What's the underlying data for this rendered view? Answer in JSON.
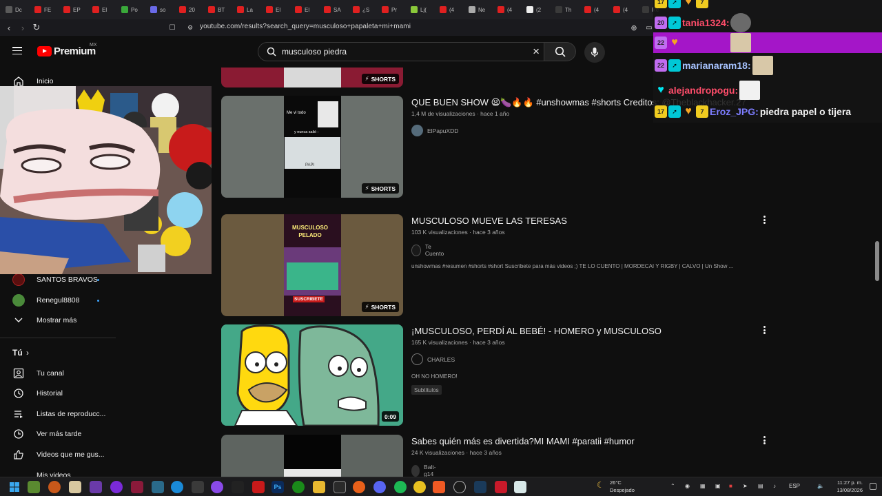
{
  "browser": {
    "tabs": [
      "Dc",
      "FE",
      "EP",
      "El",
      "Po",
      "so",
      "20",
      "BT",
      "La",
      "El",
      "El",
      "SA",
      "¿S",
      "Pr",
      "Lj(",
      "(4",
      "Ne",
      "(4",
      "(2",
      "Th",
      "(4",
      "(4",
      "Re"
    ],
    "url": "youtube.com/results?search_query=musculoso+papaleta+mi+mami"
  },
  "youtube": {
    "logo_text": "Premium",
    "country_code": "MX",
    "search_value": "musculoso piedra",
    "sidebar": {
      "home_label": "Inicio",
      "subscriptions": [
        {
          "label": "SANTOS BRAVOS"
        },
        {
          "label": "Renegul8808"
        }
      ],
      "show_more": "Mostrar más",
      "you_section": "Tú",
      "you_items": [
        {
          "label": "Tu canal",
          "icon": "channel-icon"
        },
        {
          "label": "Historial",
          "icon": "history-icon"
        },
        {
          "label": "Listas de reproducc...",
          "icon": "playlist-icon"
        },
        {
          "label": "Ver más tarde",
          "icon": "clock-icon"
        },
        {
          "label": "Videos que me gus...",
          "icon": "like-icon"
        },
        {
          "label": "Mis videos",
          "icon": "video-icon"
        }
      ]
    },
    "results": [
      {
        "title": "QUE BUEN SHOW 😫🍆🔥🔥 #unshowmas #shorts Creditos: @Theblackhacker.27",
        "views": "1,4 M de visualizaciones",
        "age": "hace 1 año",
        "channel": "ElPapuXDD",
        "badge": "SHORTS",
        "thumb_text_top": "Me vi todo",
        "thumb_text_mid": "y nunca salió :",
        "thumb_text_bottom": "PAPI"
      },
      {
        "title": "MUSCULOSO MUEVE LAS TERESAS",
        "views": "103 K visualizaciones",
        "age": "hace 3 años",
        "channel": "Te Cuento",
        "description": "unshowmas #resumen #shorts #short Suscribete para más videos ;) TE LO CUENTO | MORDECAI Y RIGBY | CALVO | Un Show ...",
        "badge": "SHORTS",
        "thumb_text_top": "MUSCULOSO PELADO",
        "thumb_text_bottom": "SUSCRIBETE"
      },
      {
        "title": "¡MUSCULOSO, PERDÍ AL BEBÉ! - HOMERO y MUSCULOSO",
        "views": "165 K visualizaciones",
        "age": "hace 3 años",
        "channel": "CHARLES",
        "description": "OH NO HOMERO!",
        "tag": "Subtítulos",
        "badge": "0:09"
      },
      {
        "title": "Sabes quién más es divertida?MI MAMI #paratii #humor",
        "views": "24 K visualizaciones",
        "age": "hace 3 años",
        "channel": "Balt-g14"
      }
    ],
    "top_partial_badge": "SHORTS"
  },
  "chat": {
    "messages": [
      {
        "badge_num": "20",
        "name": "tania1324:",
        "name_color": "#ff4d6a",
        "msg": ""
      },
      {
        "badge_num": "22",
        "name": "",
        "name_color": "#ff4d6a",
        "msg": "",
        "highlight": true
      },
      {
        "badge_num": "22",
        "name": "marianaram18:",
        "name_color": "#a7c3ff",
        "msg": ""
      },
      {
        "badge_num": "",
        "name": "alejandropogu:",
        "name_color": "#ff4d6a",
        "msg": ""
      },
      {
        "badge_num": "17",
        "name": "Eroz_JPG:",
        "name_color": "#7d7dff",
        "msg": "piedra papel o tijera"
      }
    ]
  },
  "taskbar": {
    "weather_temp": "26°C",
    "weather_text": "Despejado",
    "lang": "ESP",
    "time": "11:27 p. m.",
    "date": "13/08/2026"
  }
}
